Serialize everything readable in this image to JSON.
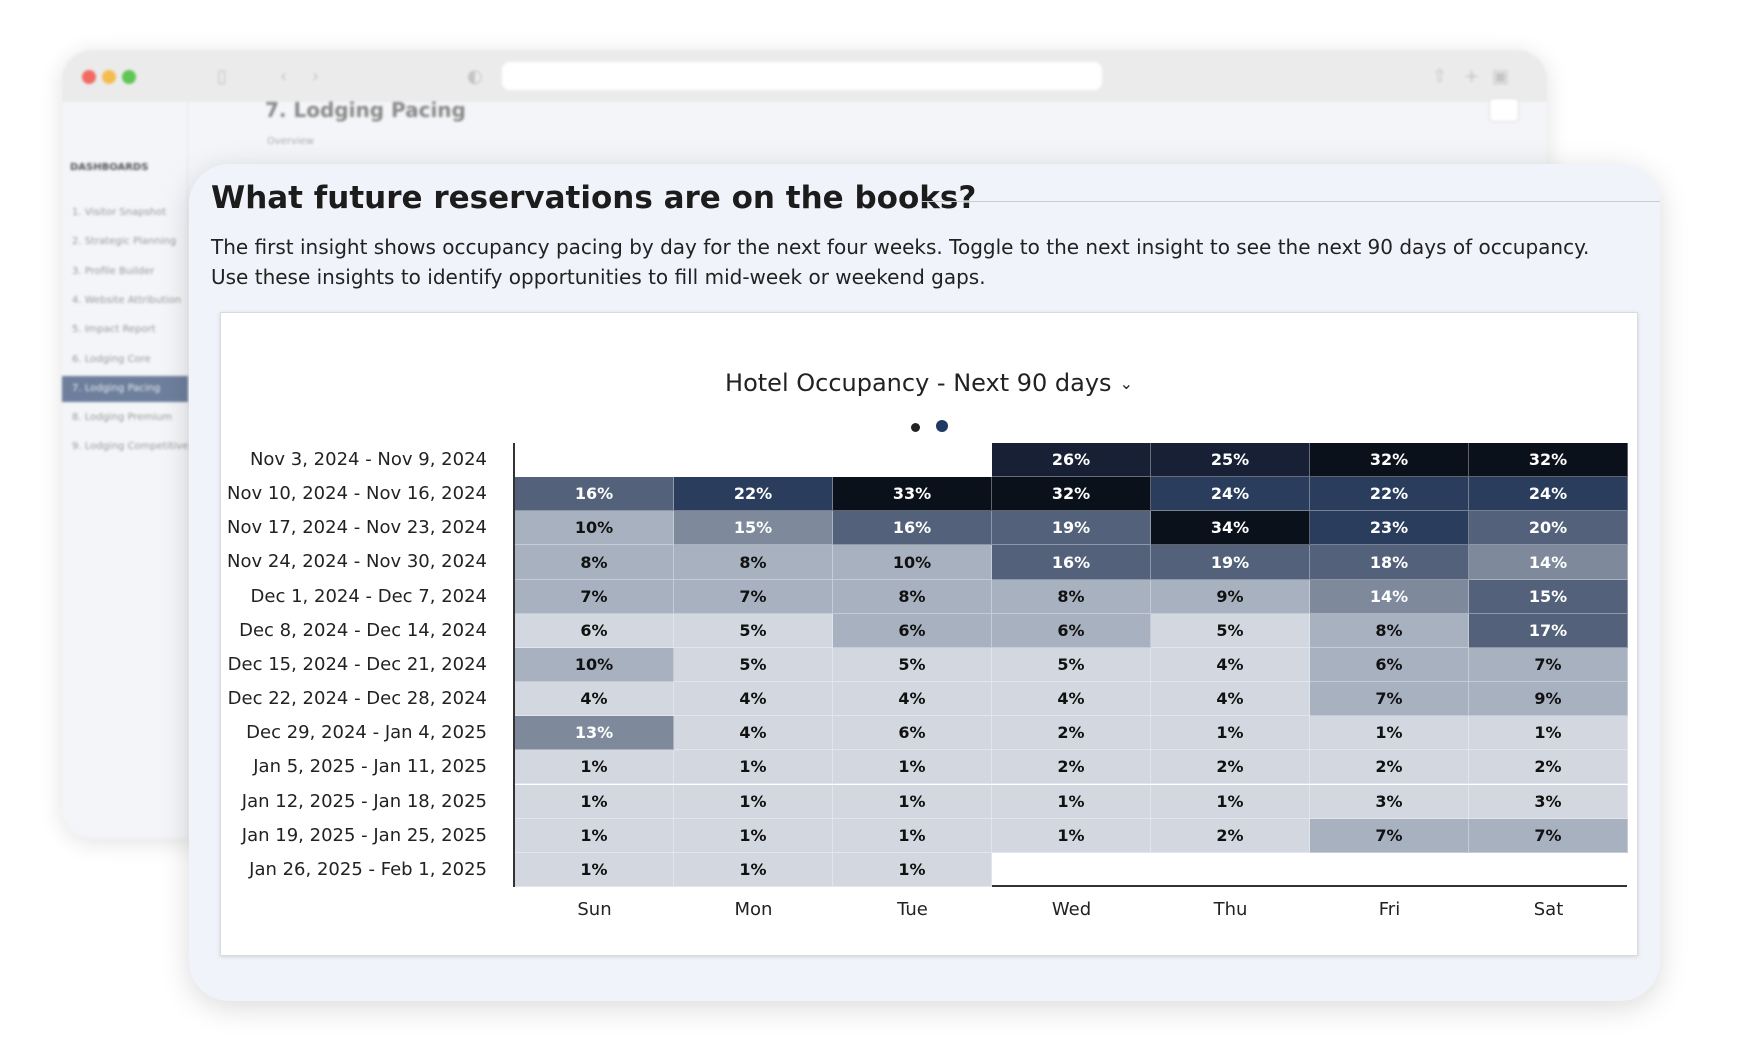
{
  "background_window": {
    "sidebar_heading": "DASHBOARDS",
    "sidebar_items": [
      "1. Visitor Snapshot",
      "2. Strategic Planning",
      "3. Profile Builder",
      "4. Website Attribution",
      "5. Impact Report",
      "6. Lodging Core",
      "7. Lodging Pacing",
      "8. Lodging Premium",
      "9. Lodging Competitive"
    ],
    "active_item": 6,
    "page_title": "7. Lodging Pacing",
    "page_subtitle": "Overview"
  },
  "card": {
    "title": "What future reservations are on the books?",
    "description": "The first insight shows occupancy pacing by day for the next four weeks. Toggle to the next insight to see the next 90 days of occupancy. Use these insights to identify opportunities to fill mid-week or weekend gaps."
  },
  "chart_data": {
    "type": "heatmap",
    "title": "Hotel Occupancy - Next 90 days",
    "pager": {
      "pages": 2,
      "current": 2
    },
    "columns": [
      "Sun",
      "Mon",
      "Tue",
      "Wed",
      "Thu",
      "Fri",
      "Sat"
    ],
    "rows": [
      "Nov 3, 2024 - Nov 9, 2024",
      "Nov 10, 2024 - Nov 16, 2024",
      "Nov 17, 2024 - Nov 23, 2024",
      "Nov 24, 2024 - Nov 30, 2024",
      "Dec 1, 2024 - Dec 7, 2024",
      "Dec 8, 2024 - Dec 14, 2024",
      "Dec 15, 2024 - Dec 21, 2024",
      "Dec 22, 2024 - Dec 28, 2024",
      "Dec 29, 2024 - Jan 4, 2025",
      "Jan 5, 2025 - Jan 11, 2025",
      "Jan 12, 2025 - Jan 18, 2025",
      "Jan 19, 2025 - Jan 25, 2025",
      "Jan 26, 2025 - Feb 1, 2025"
    ],
    "values": [
      [
        null,
        null,
        null,
        26,
        25,
        32,
        32
      ],
      [
        16,
        22,
        33,
        32,
        24,
        22,
        24
      ],
      [
        10,
        15,
        16,
        19,
        34,
        23,
        20
      ],
      [
        8,
        8,
        10,
        16,
        19,
        18,
        14
      ],
      [
        7,
        7,
        8,
        8,
        9,
        14,
        15
      ],
      [
        6,
        5,
        6,
        6,
        5,
        8,
        17
      ],
      [
        10,
        5,
        5,
        5,
        4,
        6,
        7
      ],
      [
        4,
        4,
        4,
        4,
        4,
        7,
        9
      ],
      [
        13,
        4,
        6,
        2,
        1,
        1,
        1
      ],
      [
        1,
        1,
        1,
        2,
        2,
        2,
        2
      ],
      [
        1,
        1,
        1,
        1,
        1,
        3,
        3
      ],
      [
        1,
        1,
        1,
        1,
        2,
        7,
        7
      ],
      [
        1,
        1,
        1,
        null,
        null,
        null,
        null
      ]
    ],
    "color_levels": [
      [
        null,
        null,
        null,
        5,
        5,
        6,
        6
      ],
      [
        3,
        4,
        6,
        6,
        4,
        4,
        4
      ],
      [
        1,
        2,
        3,
        3,
        6,
        4,
        3
      ],
      [
        1,
        1,
        1,
        3,
        3,
        3,
        2
      ],
      [
        1,
        1,
        1,
        1,
        1,
        2,
        3
      ],
      [
        0,
        0,
        1,
        1,
        0,
        1,
        3
      ],
      [
        1,
        0,
        0,
        0,
        0,
        1,
        1
      ],
      [
        0,
        0,
        0,
        0,
        0,
        1,
        1
      ],
      [
        2,
        0,
        0,
        0,
        0,
        0,
        0
      ],
      [
        0,
        0,
        0,
        0,
        0,
        0,
        0
      ],
      [
        0,
        0,
        0,
        0,
        0,
        0,
        0
      ],
      [
        0,
        0,
        0,
        0,
        0,
        1,
        1
      ],
      [
        0,
        0,
        0,
        null,
        null,
        null,
        null
      ]
    ],
    "palette": [
      "#d3d8e0",
      "#a8b1c0",
      "#7e8a9c",
      "#53627a",
      "#2b3d5c",
      "#172035",
      "#0b111b"
    ],
    "value_format": "percent"
  }
}
